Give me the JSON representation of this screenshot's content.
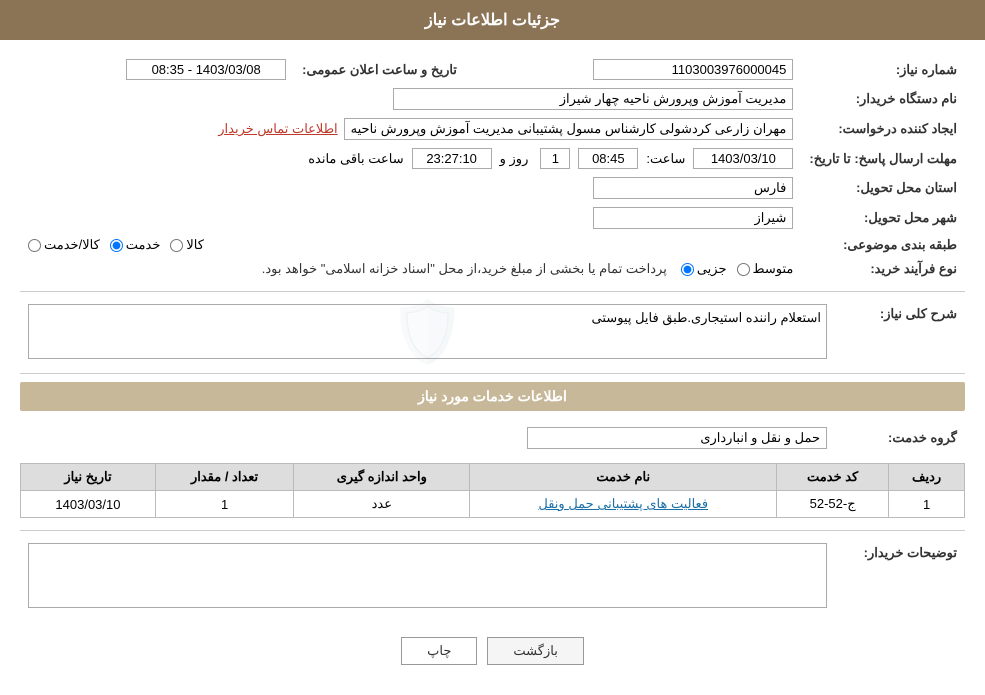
{
  "header": {
    "title": "جزئیات اطلاعات نیاز"
  },
  "sections": {
    "need_info": {
      "need_number_label": "شماره نیاز:",
      "need_number_value": "1103003976000045",
      "announcement_datetime_label": "تاریخ و ساعت اعلان عمومی:",
      "announcement_datetime_value": "1403/03/08 - 08:35",
      "buyer_org_label": "نام دستگاه خریدار:",
      "buyer_org_value": "مدیریت آموزش وپرورش ناحیه چهار شیراز",
      "creator_label": "ایجاد کننده درخواست:",
      "creator_value": "مهران زارعی کردشولی کارشناس مسول پشتیبانی مدیریت آموزش وپرورش ناحیه",
      "creator_link": "اطلاعات تماس خریدار",
      "response_deadline_label": "مهلت ارسال پاسخ: تا تاریخ:",
      "response_date_value": "1403/03/10",
      "response_time_label": "ساعت:",
      "response_time_value": "08:45",
      "response_days_label": "روز و",
      "response_days_value": "1",
      "response_remaining_label": "ساعت باقی مانده",
      "response_remaining_value": "23:27:10",
      "delivery_province_label": "استان محل تحویل:",
      "delivery_province_value": "فارس",
      "delivery_city_label": "شهر محل تحویل:",
      "delivery_city_value": "شیراز",
      "category_label": "طبقه بندی موضوعی:",
      "category_options": [
        "کالا",
        "خدمت",
        "کالا/خدمت"
      ],
      "category_selected": "خدمت",
      "purchase_type_label": "نوع فرآیند خرید:",
      "purchase_type_note": "پرداخت تمام یا بخشی از مبلغ خرید،از محل \"اسناد خزانه اسلامی\" خواهد بود.",
      "purchase_type_options": [
        "جزیی",
        "متوسط"
      ],
      "purchase_type_selected": "جزیی"
    },
    "need_description": {
      "title": "شرح کلی نیاز:",
      "value": "استعلام راننده استیجاری.طبق فایل پیوستی"
    },
    "services_section": {
      "title": "اطلاعات خدمات مورد نیاز",
      "service_group_label": "گروه خدمت:",
      "service_group_value": "حمل و نقل و انبارداری",
      "table_columns": [
        "ردیف",
        "کد خدمت",
        "نام خدمت",
        "واحد اندازه گیری",
        "تعداد / مقدار",
        "تاریخ نیاز"
      ],
      "table_rows": [
        {
          "row": "1",
          "code": "ج-52-52",
          "name": "فعالیت های پشتیبانی حمل ونقل",
          "unit": "عدد",
          "quantity": "1",
          "date": "1403/03/10"
        }
      ]
    },
    "buyer_description": {
      "title": "توضیحات خریدار:",
      "value": ""
    }
  },
  "buttons": {
    "print_label": "چاپ",
    "back_label": "بازگشت"
  }
}
